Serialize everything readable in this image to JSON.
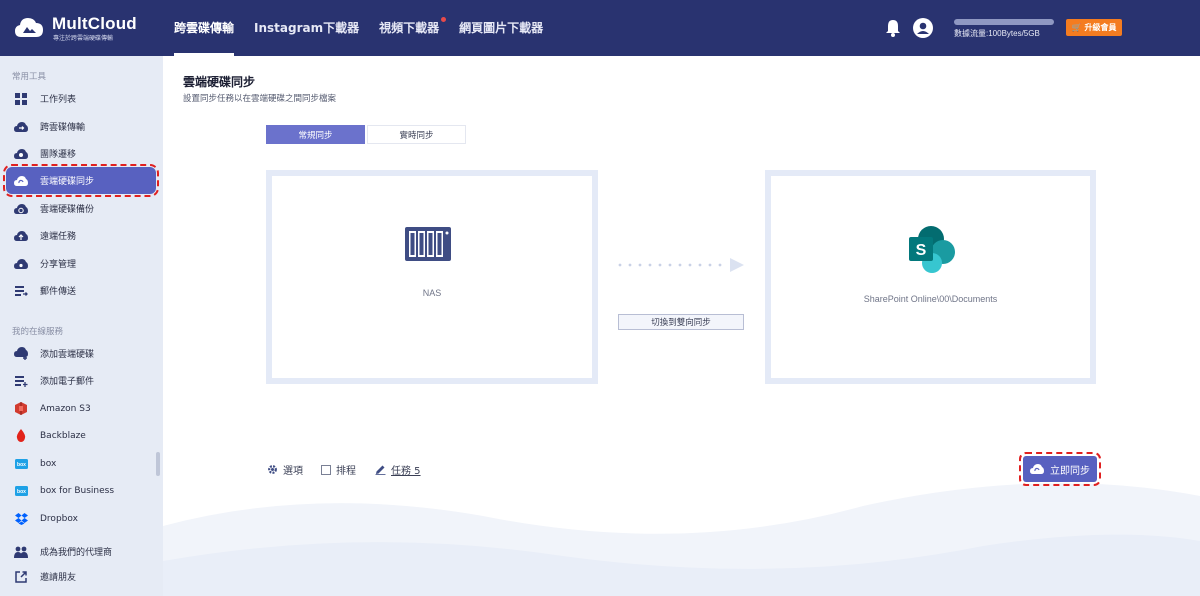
{
  "app": {
    "brand": "MultCloud",
    "tagline": "專注於跨雲端硬碟傳輸"
  },
  "nav": {
    "items": [
      "跨雲碟傳輸",
      "Instagram下載器",
      "視頻下載器",
      "網頁圖片下載器"
    ],
    "active_index": 0
  },
  "header": {
    "traffic_label": "數據流量:100Bytes/5GB",
    "traffic_used_fraction": 0.0,
    "upgrade_label": "升級會員"
  },
  "sidebar": {
    "section_tools": "常用工具",
    "tools": [
      {
        "label": "工作列表",
        "icon": "grid-icon"
      },
      {
        "label": "跨雲碟傳輸",
        "icon": "cloud-transfer-icon"
      },
      {
        "label": "團隊遷移",
        "icon": "cloud-team-icon"
      },
      {
        "label": "雲端硬碟同步",
        "icon": "cloud-sync-icon",
        "active": true
      },
      {
        "label": "雲端硬碟備份",
        "icon": "cloud-backup-icon"
      },
      {
        "label": "遠端任務",
        "icon": "cloud-upload-icon"
      },
      {
        "label": "分享管理",
        "icon": "cloud-share-icon"
      },
      {
        "label": "郵件傳送",
        "icon": "email-migration-icon"
      }
    ],
    "section_drives": "我的在線服務",
    "drives": [
      {
        "label": "添加雲端硬碟",
        "icon": "add-cloud-icon"
      },
      {
        "label": "添加電子郵件",
        "icon": "add-email-icon"
      },
      {
        "label": "Amazon S3",
        "icon": "amazon-s3-icon"
      },
      {
        "label": "Backblaze",
        "icon": "backblaze-icon"
      },
      {
        "label": "box",
        "icon": "box-icon"
      },
      {
        "label": "box for Business",
        "icon": "box-business-icon"
      },
      {
        "label": "Dropbox",
        "icon": "dropbox-icon"
      }
    ],
    "footer": [
      {
        "label": "成為我們的代理商",
        "icon": "partner-icon"
      },
      {
        "label": "邀請朋友",
        "icon": "share-out-icon"
      }
    ]
  },
  "main": {
    "title": "雲端硬碟同步",
    "subtitle": "設置同步任務以在雲端硬碟之間同步檔案",
    "tabs": [
      "常規同步",
      "實時同步"
    ],
    "source_label": "NAS",
    "target_label": "SharePoint Online\\00\\Documents",
    "switch_label": "切換到雙向同步",
    "options_label": "選項",
    "schedule_label": "排程",
    "task_label": "任務 5",
    "sync_now_label": "立即同步"
  },
  "colors": {
    "topbar": "#293370",
    "accent": "#5861c0",
    "upgrade": "#f47c20",
    "highlight": "#e02020"
  }
}
